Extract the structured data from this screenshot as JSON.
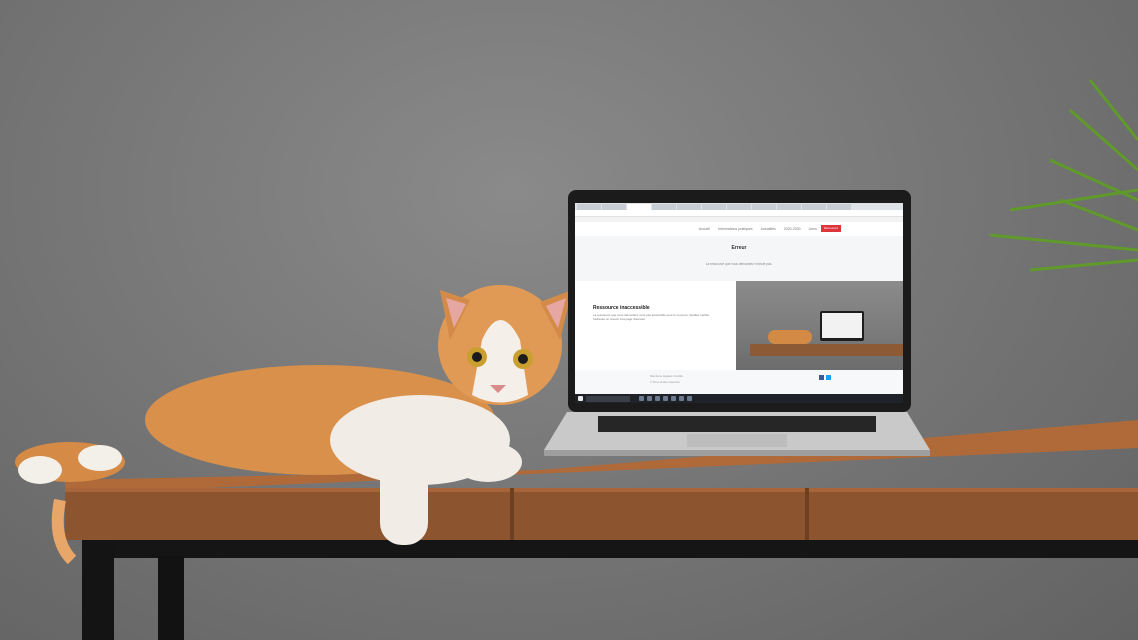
{
  "image": {
    "description_visible_text_only": true
  },
  "screen": {
    "site_nav": {
      "items": [
        "Accueil",
        "Informations pratiques",
        "Actualités",
        "2020-2030",
        "Liens",
        "Contact"
      ],
      "cta_label": "Découvrez"
    },
    "error_title": "Erreur",
    "error_message": "La ressource que vous demandez n'existe pas.",
    "content_heading": "Ressource inaccessible",
    "content_body": "La ressource que vous demandez n'est pas accessible pour le moment. Veuillez vérifier l'adresse ou revenir à la page d'accueil.",
    "footer_links": [
      "Mentions légales",
      "Crédits"
    ],
    "footer_note": "© Tous droits réservés",
    "taskbar_search": "Taper ici pour rechercher"
  },
  "colors": {
    "wall": "#7a7a7a",
    "desk_wood": "#9b5f35",
    "cta_red": "#e0343d"
  }
}
